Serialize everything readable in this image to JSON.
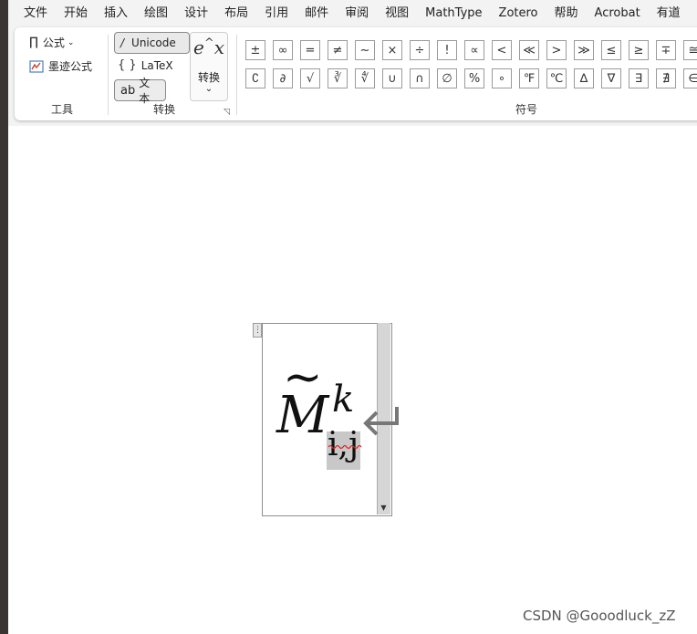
{
  "menu": [
    "文件",
    "开始",
    "插入",
    "绘图",
    "设计",
    "布局",
    "引用",
    "邮件",
    "审阅",
    "视图",
    "MathType",
    "Zotero",
    "帮助",
    "Acrobat",
    "有道"
  ],
  "ribbon": {
    "tools": {
      "formula_icon": "∏",
      "formula_label": "公式",
      "ink_label": "墨迹公式",
      "group_label": "工具"
    },
    "convert": {
      "unicode_label": "Unicode",
      "latex_label": "LaTeX",
      "text_label": "文本",
      "convert_icon": "e^x",
      "convert_label": "转换",
      "group_label": "转换"
    },
    "symbols": {
      "group_label": "符号",
      "row1": [
        "±",
        "∞",
        "=",
        "≠",
        "~",
        "×",
        "÷",
        "!",
        "∝",
        "<",
        "≪",
        ">",
        "≫",
        "≤",
        "≥",
        "∓",
        "≅"
      ],
      "row2": [
        "∁",
        "∂",
        "√",
        "∛",
        "∜",
        "∪",
        "∩",
        "∅",
        "%",
        "∘",
        "℉",
        "℃",
        "∆",
        "∇",
        "∃",
        "∄",
        "∈"
      ]
    }
  },
  "equation": {
    "base": "M",
    "accent": "~",
    "superscript": "k",
    "subscript": "i,j"
  },
  "watermark": "CSDN @Gooodluck_zZ"
}
